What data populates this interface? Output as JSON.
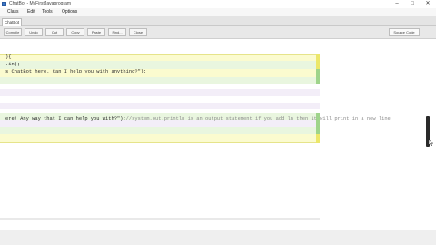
{
  "window": {
    "title": "ChatBot - MyFirstJavaprogram",
    "minimize": "–",
    "maximize": "□",
    "close": "✕"
  },
  "menu": {
    "items": [
      "Class",
      "Edit",
      "Tools",
      "Options"
    ]
  },
  "tabs": [
    {
      "label": "ChatBot"
    }
  ],
  "toolbar": {
    "buttons": [
      "Compile",
      "Undo",
      "Cut",
      "Copy",
      "Paste",
      "Find...",
      "Close"
    ],
    "theme": "Source Code"
  },
  "editor": {
    "lines": [
      {
        "text": "){"
      },
      {
        "text": ".in);"
      },
      {
        "text": "s ChatBot here. Can I help you with anything?\");"
      },
      {
        "text": "ere! Any way that I can help you with?\");",
        "comment": "//system.out.println is an output statement if you add ln then it will print in a new line"
      }
    ]
  },
  "colors": {
    "yellow_band": "#fbfbcf",
    "yellow_border": "#e6e48a",
    "green_band": "#e9f6df",
    "lavender_band": "#f3eef8",
    "gutter_green": "#9fd48b",
    "gutter_yellow": "#ece76a"
  },
  "icons": {
    "app": "bluej-icon",
    "cursor": "mouse-pointer-icon"
  }
}
